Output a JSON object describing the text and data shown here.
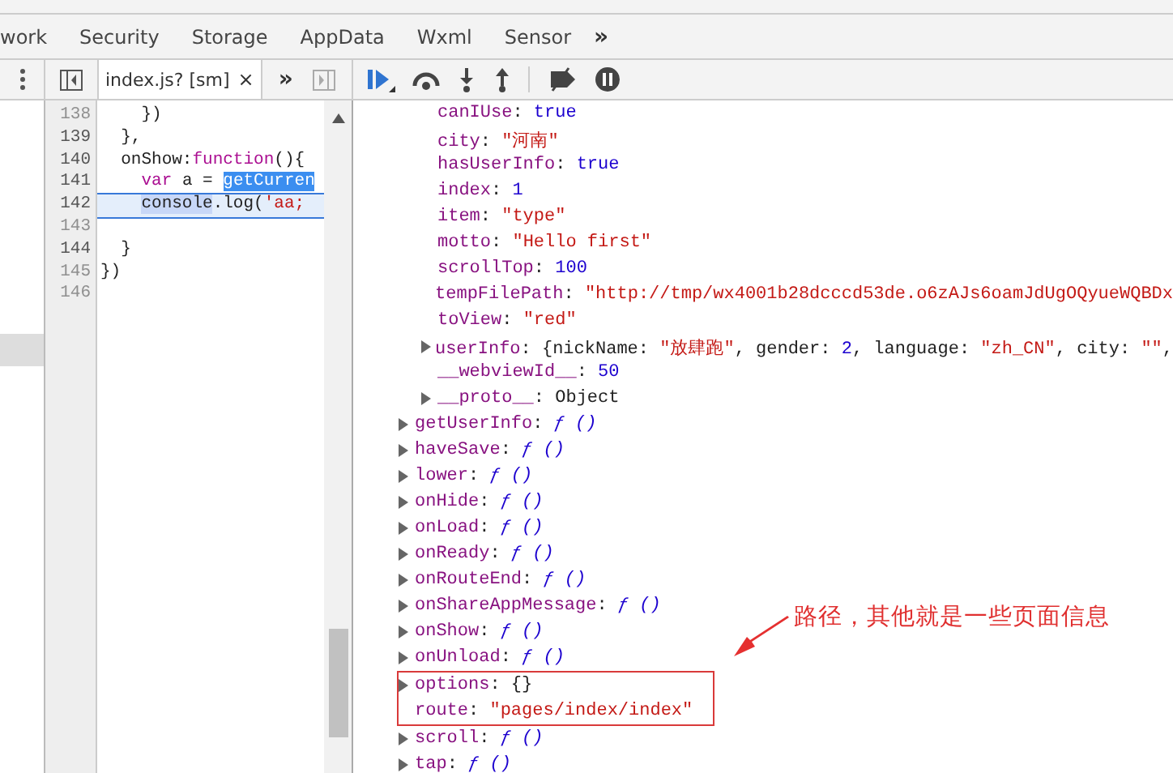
{
  "panel_tabs": [
    {
      "label": "work",
      "selected": false
    },
    {
      "label": "Security",
      "selected": false
    },
    {
      "label": "Storage",
      "selected": false
    },
    {
      "label": "AppData",
      "selected": false
    },
    {
      "label": "Wxml",
      "selected": false
    },
    {
      "label": "Sensor",
      "selected": false
    }
  ],
  "more_tabs": "»",
  "editor_tab": {
    "label": "index.js? [sm]",
    "close": "×",
    "more": "»"
  },
  "navigator": {
    "rows": [
      {
        "selected": false
      },
      {
        "selected": false
      },
      {
        "selected": false
      },
      {
        "selected": false
      },
      {
        "selected": false
      },
      {
        "selected": false
      },
      {
        "selected": false
      },
      {
        "selected": false
      },
      {
        "selected": true
      }
    ]
  },
  "code_lines": [
    {
      "number": "138",
      "mapped": false,
      "current": false,
      "tokens": [
        {
          "text": "    })",
          "kind": "plain"
        }
      ]
    },
    {
      "number": "139",
      "mapped": true,
      "current": false,
      "tokens": [
        {
          "text": "  },",
          "kind": "plain"
        }
      ]
    },
    {
      "number": "140",
      "mapped": true,
      "current": false,
      "tokens": [
        {
          "text": "  onShow:",
          "kind": "plain"
        },
        {
          "text": "function",
          "kind": "keyword"
        },
        {
          "text": "(){",
          "kind": "plain"
        }
      ]
    },
    {
      "number": "141",
      "mapped": true,
      "current": false,
      "tokens": [
        {
          "text": "    var",
          "kind": "keyword"
        },
        {
          "text": " a = ",
          "kind": "plain"
        },
        {
          "text": "getCurren",
          "kind": "selection"
        }
      ]
    },
    {
      "number": "142",
      "mapped": true,
      "current": true,
      "tokens": [
        {
          "text": "    console",
          "kind": "match"
        },
        {
          "text": ".log(",
          "kind": "plain"
        },
        {
          "text": "'aa;",
          "kind": "string"
        }
      ]
    },
    {
      "number": "143",
      "mapped": false,
      "current": false
    },
    {
      "number": "144",
      "mapped": true,
      "current": false,
      "tokens": [
        {
          "text": "  }",
          "kind": "plain"
        }
      ]
    },
    {
      "number": "145",
      "mapped": false,
      "current": false,
      "tokens": [
        {
          "text": "})",
          "kind": "plain"
        }
      ]
    },
    {
      "number": "146",
      "mapped": false,
      "current": false
    }
  ],
  "data_entries": [
    {
      "expandable": false,
      "tokens": [
        {
          "text": "canIUse",
          "kind": "key"
        },
        {
          "text": ": ",
          "kind": "plain"
        },
        {
          "text": "true",
          "kind": "literal"
        }
      ]
    },
    {
      "expandable": false,
      "tokens": [
        {
          "text": "city",
          "kind": "key"
        },
        {
          "text": ": ",
          "kind": "plain"
        },
        {
          "text": "\"河南\"",
          "kind": "string"
        }
      ]
    },
    {
      "expandable": false,
      "tokens": [
        {
          "text": "hasUserInfo",
          "kind": "key"
        },
        {
          "text": ": ",
          "kind": "plain"
        },
        {
          "text": "true",
          "kind": "literal"
        }
      ]
    },
    {
      "expandable": false,
      "tokens": [
        {
          "text": "index",
          "kind": "key"
        },
        {
          "text": ": ",
          "kind": "plain"
        },
        {
          "text": "1",
          "kind": "literal"
        }
      ]
    },
    {
      "expandable": false,
      "tokens": [
        {
          "text": "item",
          "kind": "key"
        },
        {
          "text": ": ",
          "kind": "plain"
        },
        {
          "text": "\"type\"",
          "kind": "string"
        }
      ]
    },
    {
      "expandable": false,
      "tokens": [
        {
          "text": "motto",
          "kind": "key"
        },
        {
          "text": ": ",
          "kind": "plain"
        },
        {
          "text": "\"Hello first\"",
          "kind": "string"
        }
      ]
    },
    {
      "expandable": false,
      "tokens": [
        {
          "text": "scrollTop",
          "kind": "key"
        },
        {
          "text": ": ",
          "kind": "plain"
        },
        {
          "text": "100",
          "kind": "literal"
        }
      ]
    },
    {
      "expandable": false,
      "tokens": [
        {
          "text": "tempFilePath",
          "kind": "key"
        },
        {
          "text": ": ",
          "kind": "plain"
        },
        {
          "text": "\"http://tmp/wx4001b28dcccd53de.o6zAJs6oamJdUgOQyueWQBDx",
          "kind": "string"
        }
      ]
    },
    {
      "expandable": false,
      "tokens": [
        {
          "text": "toView",
          "kind": "key"
        },
        {
          "text": ": ",
          "kind": "plain"
        },
        {
          "text": "\"red\"",
          "kind": "string"
        }
      ]
    },
    {
      "expandable": true,
      "tokens": [
        {
          "text": "userInfo",
          "kind": "key"
        },
        {
          "text": ": {nickName: ",
          "kind": "plain"
        },
        {
          "text": "\"放肆跑\"",
          "kind": "string"
        },
        {
          "text": ", gender: ",
          "kind": "plain"
        },
        {
          "text": "2",
          "kind": "literal"
        },
        {
          "text": ", language: ",
          "kind": "plain"
        },
        {
          "text": "\"zh_CN\"",
          "kind": "string"
        },
        {
          "text": ", city: ",
          "kind": "plain"
        },
        {
          "text": "\"\"",
          "kind": "string"
        },
        {
          "text": ",",
          "kind": "plain"
        }
      ]
    },
    {
      "expandable": false,
      "tokens": [
        {
          "text": "__webviewId__",
          "kind": "key"
        },
        {
          "text": ": ",
          "kind": "plain"
        },
        {
          "text": "50",
          "kind": "literal"
        }
      ]
    },
    {
      "expandable": true,
      "tokens": [
        {
          "text": "__proto__",
          "kind": "key"
        },
        {
          "text": ": Object",
          "kind": "plain"
        }
      ]
    }
  ],
  "page_entries": [
    {
      "expandable": true,
      "boxed": false,
      "tokens": [
        {
          "text": "getUserInfo",
          "kind": "key"
        },
        {
          "text": ": ",
          "kind": "plain"
        },
        {
          "text": "ƒ ()",
          "kind": "function"
        }
      ]
    },
    {
      "expandable": true,
      "boxed": false,
      "tokens": [
        {
          "text": "haveSave",
          "kind": "key"
        },
        {
          "text": ": ",
          "kind": "plain"
        },
        {
          "text": "ƒ ()",
          "kind": "function"
        }
      ]
    },
    {
      "expandable": true,
      "boxed": false,
      "tokens": [
        {
          "text": "lower",
          "kind": "key"
        },
        {
          "text": ": ",
          "kind": "plain"
        },
        {
          "text": "ƒ ()",
          "kind": "function"
        }
      ]
    },
    {
      "expandable": true,
      "boxed": false,
      "tokens": [
        {
          "text": "onHide",
          "kind": "key"
        },
        {
          "text": ": ",
          "kind": "plain"
        },
        {
          "text": "ƒ ()",
          "kind": "function"
        }
      ]
    },
    {
      "expandable": true,
      "boxed": false,
      "tokens": [
        {
          "text": "onLoad",
          "kind": "key"
        },
        {
          "text": ": ",
          "kind": "plain"
        },
        {
          "text": "ƒ ()",
          "kind": "function"
        }
      ]
    },
    {
      "expandable": true,
      "boxed": false,
      "tokens": [
        {
          "text": "onReady",
          "kind": "key"
        },
        {
          "text": ": ",
          "kind": "plain"
        },
        {
          "text": "ƒ ()",
          "kind": "function"
        }
      ]
    },
    {
      "expandable": true,
      "boxed": false,
      "tokens": [
        {
          "text": "onRouteEnd",
          "kind": "key"
        },
        {
          "text": ": ",
          "kind": "plain"
        },
        {
          "text": "ƒ ()",
          "kind": "function"
        }
      ]
    },
    {
      "expandable": true,
      "boxed": false,
      "tokens": [
        {
          "text": "onShareAppMessage",
          "kind": "key"
        },
        {
          "text": ": ",
          "kind": "plain"
        },
        {
          "text": "ƒ ()",
          "kind": "function"
        }
      ]
    },
    {
      "expandable": true,
      "boxed": false,
      "tokens": [
        {
          "text": "onShow",
          "kind": "key"
        },
        {
          "text": ": ",
          "kind": "plain"
        },
        {
          "text": "ƒ ()",
          "kind": "function"
        }
      ]
    },
    {
      "expandable": true,
      "boxed": false,
      "tokens": [
        {
          "text": "onUnload",
          "kind": "key"
        },
        {
          "text": ": ",
          "kind": "plain"
        },
        {
          "text": "ƒ ()",
          "kind": "function"
        }
      ]
    },
    {
      "expandable": true,
      "boxed": true,
      "tokens": [
        {
          "text": "options",
          "kind": "key"
        },
        {
          "text": ": {}",
          "kind": "plain"
        }
      ]
    },
    {
      "expandable": false,
      "boxed": true,
      "tokens": [
        {
          "text": "route",
          "kind": "key"
        },
        {
          "text": ": ",
          "kind": "plain"
        },
        {
          "text": "\"pages/index/index\"",
          "kind": "string"
        }
      ]
    },
    {
      "expandable": true,
      "boxed": false,
      "tokens": [
        {
          "text": "scroll",
          "kind": "key"
        },
        {
          "text": ": ",
          "kind": "plain"
        },
        {
          "text": "ƒ ()",
          "kind": "function"
        }
      ]
    },
    {
      "expandable": true,
      "boxed": false,
      "tokens": [
        {
          "text": "tap",
          "kind": "key"
        },
        {
          "text": ": ",
          "kind": "plain"
        },
        {
          "text": "ƒ ()",
          "kind": "function"
        }
      ]
    }
  ],
  "annotation": {
    "text": "路径，其他就是一些页面信息"
  }
}
